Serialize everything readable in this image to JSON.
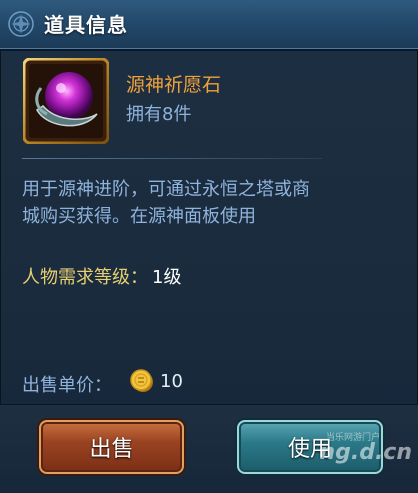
{
  "header": {
    "title": "道具信息"
  },
  "item": {
    "name": "源神祈愿石",
    "owned": "拥有8件",
    "description": "用于源神进阶，可通过永恒之塔或商城购买获得。在源神面板使用",
    "requirement_label": "人物需求等级：",
    "requirement_value": "1级"
  },
  "price": {
    "label": "出售单价：",
    "value": "10"
  },
  "buttons": {
    "sell": "出售",
    "use": "使用"
  },
  "watermark": {
    "site": "ng.d.cn",
    "small": "当乐网游门户"
  },
  "colors": {
    "item_name": "#f0a23a",
    "body_text": "#8fb3dc",
    "requirement": "#e6cf72"
  },
  "icons": {
    "emblem": "title-emblem-icon",
    "item": "purple-orb-stone-icon",
    "coin": "gold-coin-icon"
  }
}
